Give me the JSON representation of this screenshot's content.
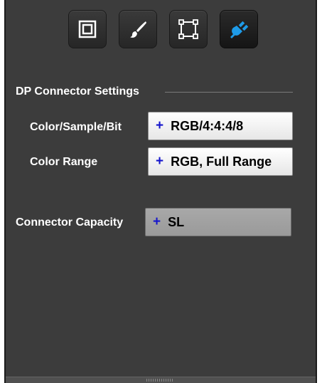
{
  "toolbar": {
    "buttons": [
      {
        "icon": "frame-icon",
        "active": false
      },
      {
        "icon": "paintbrush-icon",
        "active": false
      },
      {
        "icon": "crop-corners-icon",
        "active": false
      },
      {
        "icon": "plug-connector-icon",
        "active": true
      }
    ],
    "accent_color": "#1e9be8"
  },
  "section": {
    "title": "DP Connector Settings"
  },
  "settings": {
    "color_sample_bit": {
      "label": "Color/Sample/Bit",
      "value": "RGB/4:4:4/8"
    },
    "color_range": {
      "label": "Color Range",
      "value": "RGB, Full Range"
    },
    "connector_capacity": {
      "label": "Connector Capacity",
      "value": "SL"
    }
  },
  "field_prefix": "+"
}
